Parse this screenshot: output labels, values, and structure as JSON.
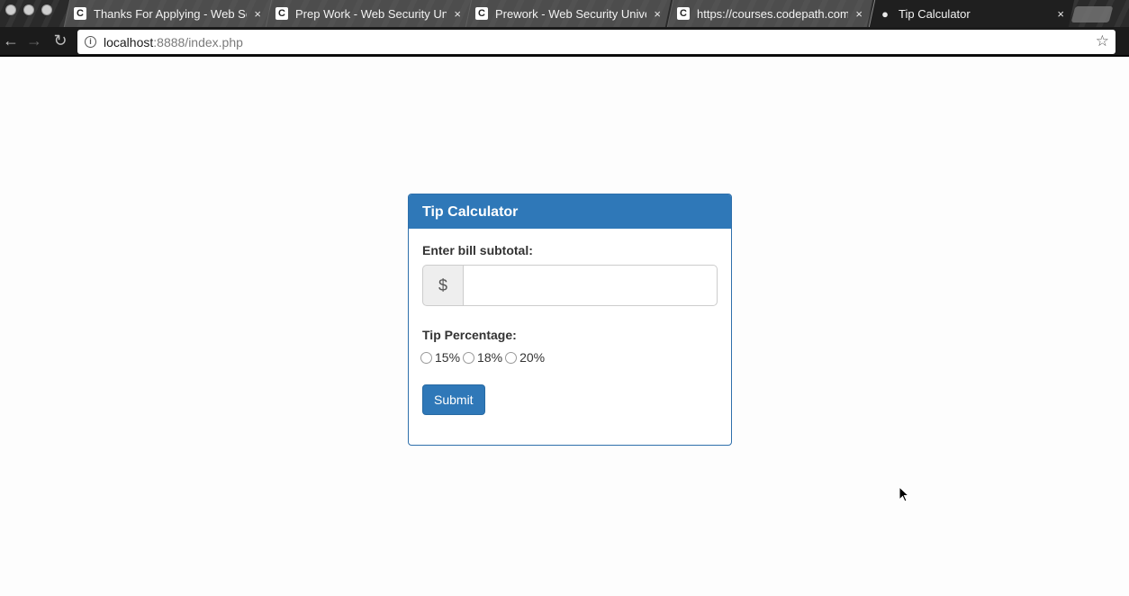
{
  "browser": {
    "tabs": [
      {
        "title": "Thanks For Applying - Web Se",
        "favicon": "C",
        "active": false
      },
      {
        "title": "Prep Work - Web Security Uni",
        "favicon": "C",
        "active": false
      },
      {
        "title": "Prework - Web Security Unive",
        "favicon": "C",
        "active": false
      },
      {
        "title": "https://courses.codepath.com",
        "favicon": "C",
        "active": false
      },
      {
        "title": "Tip Calculator",
        "favicon": "logo",
        "active": true
      }
    ],
    "close_glyph": "×",
    "url_host": "localhost",
    "url_rest": ":8888/index.php"
  },
  "calculator": {
    "title": "Tip Calculator",
    "subtotal_label": "Enter bill subtotal:",
    "currency_symbol": "$",
    "subtotal_value": "",
    "tip_label": "Tip Percentage:",
    "tip_options": [
      "15%",
      "18%",
      "20%"
    ],
    "submit_label": "Submit"
  },
  "colors": {
    "primary": "#2f78b8",
    "panel_border": "#2e6fab"
  },
  "icons": [
    "info-icon",
    "star-icon",
    "back-icon",
    "forward-icon",
    "reload-icon",
    "close-icon",
    "cursor-icon"
  ]
}
